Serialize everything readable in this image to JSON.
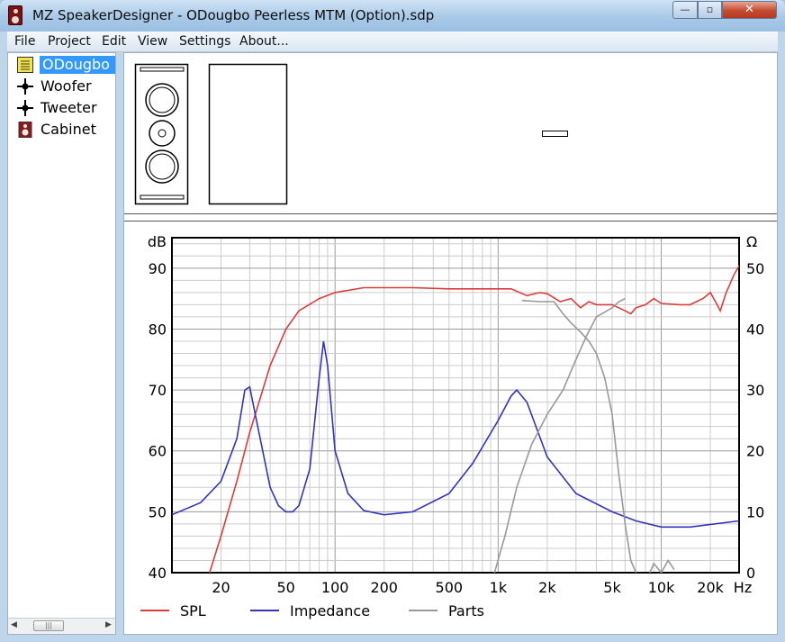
{
  "window": {
    "title": "MZ SpeakerDesigner - ODougbo Peerless MTM (Option).sdp",
    "min_icon": "minimize-icon",
    "max_icon": "maximize-icon",
    "close_icon": "close-icon",
    "min_glyph": "—",
    "max_glyph": "▫",
    "close_glyph": "✕"
  },
  "menu": [
    "File",
    "Project",
    "Edit",
    "View",
    "Settings",
    "About..."
  ],
  "tree": {
    "items": [
      {
        "label": "ODougbo",
        "icon": "project-icon",
        "selected": true
      },
      {
        "label": "Woofer",
        "icon": "driver-node-icon"
      },
      {
        "label": "Tweeter",
        "icon": "driver-node-icon"
      },
      {
        "label": "Cabinet",
        "icon": "cabinet-icon"
      }
    ],
    "scroll_left": "◀",
    "scroll_right": "▶",
    "scroll_thumb": "|||"
  },
  "chart_data": {
    "type": "line",
    "x_scale": "log",
    "xlim": [
      10,
      30000
    ],
    "ylim_left": [
      40,
      95
    ],
    "ylim_right": [
      0,
      55
    ],
    "left_unit": "dB",
    "right_unit": "Ω",
    "x_unit": "Hz",
    "grid": true,
    "legend_position": "bottom",
    "x_tick_labels": [
      {
        "v": 20,
        "t": "20"
      },
      {
        "v": 50,
        "t": "50"
      },
      {
        "v": 100,
        "t": "100"
      },
      {
        "v": 200,
        "t": "200"
      },
      {
        "v": 500,
        "t": "500"
      },
      {
        "v": 1000,
        "t": "1k"
      },
      {
        "v": 2000,
        "t": "2k"
      },
      {
        "v": 5000,
        "t": "5k"
      },
      {
        "v": 10000,
        "t": "10k"
      },
      {
        "v": 20000,
        "t": "20k"
      }
    ],
    "y_left_ticks": [
      40,
      50,
      60,
      70,
      80,
      90
    ],
    "y_right_ticks": [
      0,
      10,
      20,
      30,
      40,
      50
    ],
    "series": [
      {
        "name": "SPL",
        "color": "#dc3b3b",
        "axis": "left",
        "points": [
          [
            17,
            40
          ],
          [
            20,
            46
          ],
          [
            25,
            55
          ],
          [
            30,
            63
          ],
          [
            40,
            74
          ],
          [
            50,
            80
          ],
          [
            60,
            83
          ],
          [
            80,
            85
          ],
          [
            100,
            86
          ],
          [
            150,
            86.8
          ],
          [
            300,
            86.8
          ],
          [
            500,
            86.6
          ],
          [
            800,
            86.6
          ],
          [
            1200,
            86.6
          ],
          [
            1500,
            85.5
          ],
          [
            1800,
            86
          ],
          [
            2000,
            85.8
          ],
          [
            2400,
            84.5
          ],
          [
            2800,
            85
          ],
          [
            3200,
            83.5
          ],
          [
            3600,
            84.5
          ],
          [
            4000,
            84
          ],
          [
            5000,
            84
          ],
          [
            6000,
            83
          ],
          [
            6500,
            82.5
          ],
          [
            7000,
            83.5
          ],
          [
            8000,
            84
          ],
          [
            9000,
            85
          ],
          [
            10000,
            84.2
          ],
          [
            13000,
            84
          ],
          [
            15000,
            84
          ],
          [
            18000,
            85
          ],
          [
            20000,
            86
          ],
          [
            22000,
            84
          ],
          [
            23000,
            83
          ],
          [
            25000,
            86
          ],
          [
            28000,
            89
          ],
          [
            31000,
            91
          ],
          [
            33000,
            88
          ],
          [
            35000,
            87
          ]
        ]
      },
      {
        "name": "Impedance",
        "color": "#3333bb",
        "axis": "right",
        "points": [
          [
            10,
            9.5
          ],
          [
            15,
            11.5
          ],
          [
            20,
            15
          ],
          [
            25,
            22
          ],
          [
            28,
            30
          ],
          [
            30,
            30.5
          ],
          [
            33,
            25
          ],
          [
            40,
            14
          ],
          [
            45,
            11
          ],
          [
            50,
            10
          ],
          [
            55,
            10
          ],
          [
            60,
            11
          ],
          [
            70,
            17
          ],
          [
            80,
            32
          ],
          [
            85,
            38
          ],
          [
            90,
            34
          ],
          [
            100,
            20
          ],
          [
            120,
            13
          ],
          [
            150,
            10.2
          ],
          [
            200,
            9.5
          ],
          [
            300,
            10
          ],
          [
            500,
            13
          ],
          [
            700,
            18
          ],
          [
            1000,
            25
          ],
          [
            1200,
            29
          ],
          [
            1300,
            30
          ],
          [
            1500,
            28
          ],
          [
            2000,
            19
          ],
          [
            3000,
            13
          ],
          [
            5000,
            10
          ],
          [
            7000,
            8.5
          ],
          [
            10000,
            7.5
          ],
          [
            15000,
            7.5
          ],
          [
            30000,
            8.5
          ]
        ]
      },
      {
        "name": "Parts",
        "color": "#999999",
        "axis": "left",
        "segments": [
          [
            [
              1400,
              84.7
            ],
            [
              1800,
              84.5
            ],
            [
              2200,
              84.5
            ],
            [
              2500,
              82.5
            ],
            [
              2800,
              81
            ],
            [
              3200,
              79.5
            ],
            [
              3600,
              78
            ],
            [
              4000,
              76
            ],
            [
              4500,
              72
            ],
            [
              5000,
              66
            ],
            [
              5500,
              56
            ],
            [
              6000,
              48
            ],
            [
              6500,
              42
            ],
            [
              7000,
              40
            ]
          ],
          [
            [
              950,
              40
            ],
            [
              1100,
              46
            ],
            [
              1300,
              54
            ],
            [
              1600,
              61
            ],
            [
              2000,
              66
            ],
            [
              2500,
              70
            ],
            [
              3000,
              75
            ],
            [
              3500,
              79
            ],
            [
              4000,
              82
            ],
            [
              5000,
              83.5
            ],
            [
              5500,
              84.5
            ],
            [
              6000,
              85
            ]
          ],
          [
            [
              8500,
              40
            ],
            [
              9000,
              41.5
            ],
            [
              10000,
              40
            ],
            [
              11000,
              42
            ],
            [
              12000,
              40.5
            ]
          ]
        ]
      }
    ]
  }
}
